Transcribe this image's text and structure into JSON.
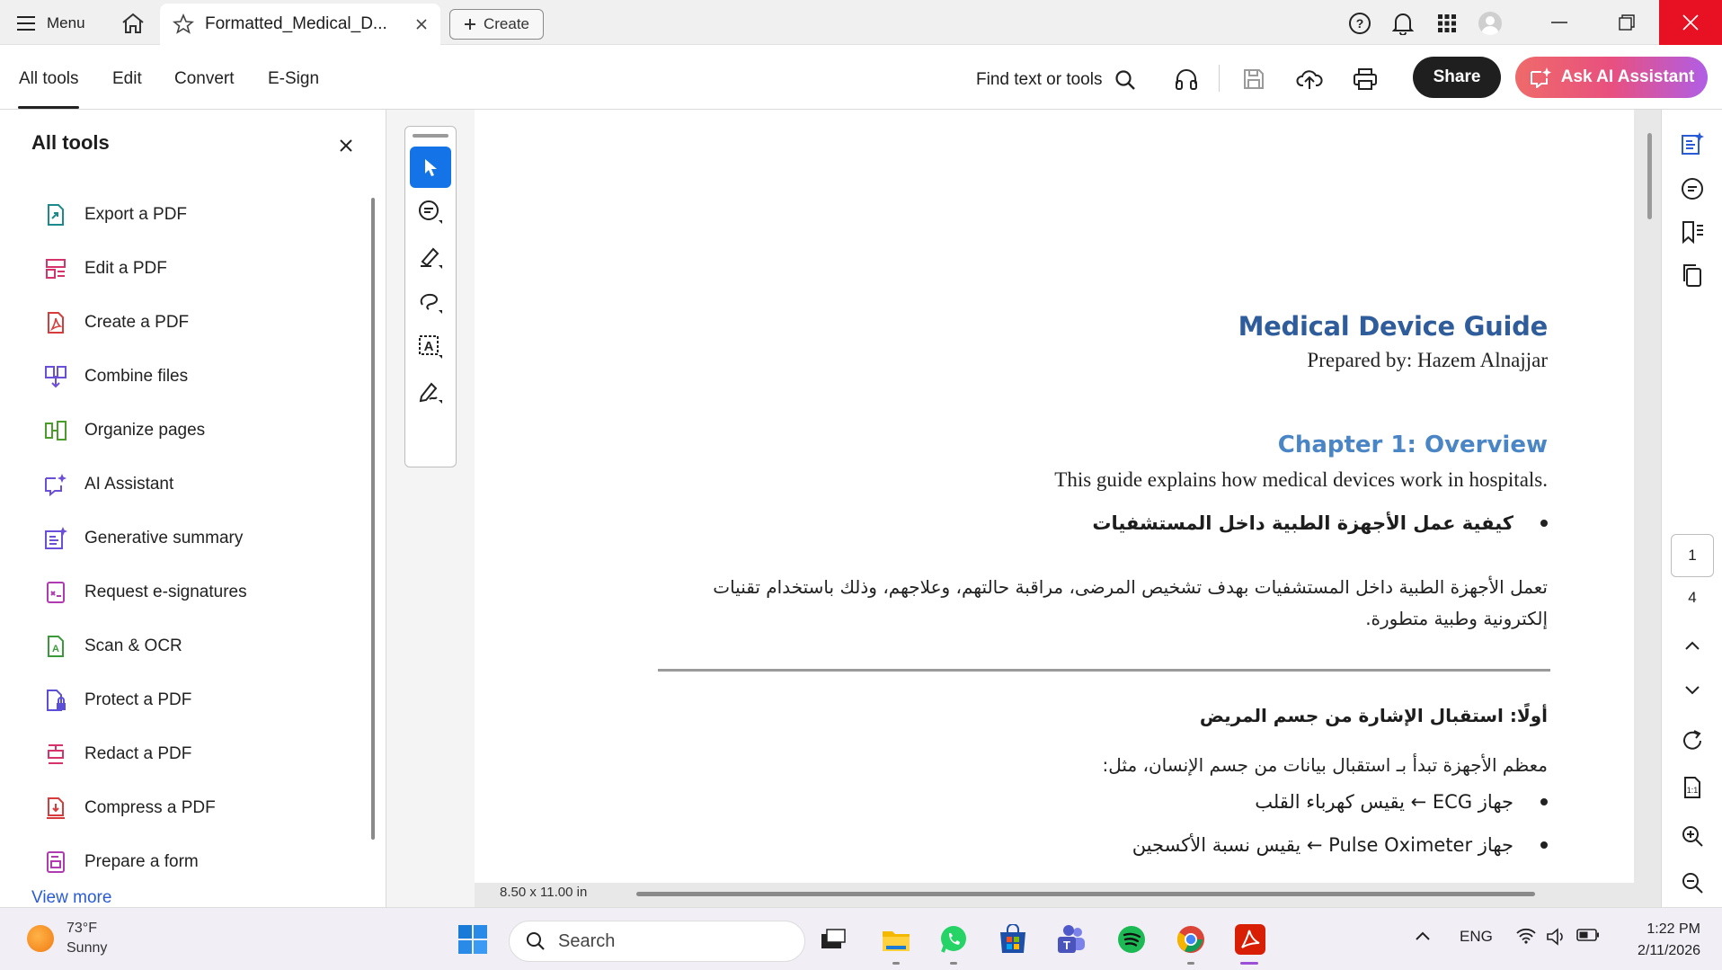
{
  "titlebar": {
    "menu_label": "Menu",
    "doc_tab_title": "Formatted_Medical_D...",
    "create_label": "Create"
  },
  "toolbar": {
    "tabs": [
      "All tools",
      "Edit",
      "Convert",
      "E-Sign"
    ],
    "find_label": "Find text or tools",
    "share_label": "Share",
    "ai_label": "Ask AI Assistant"
  },
  "left_panel": {
    "title": "All tools",
    "items": [
      {
        "label": "Export a PDF",
        "icon": "export-pdf-icon",
        "color": "#1a8a8a"
      },
      {
        "label": "Edit a PDF",
        "icon": "edit-pdf-icon",
        "color": "#d6336c"
      },
      {
        "label": "Create a PDF",
        "icon": "create-pdf-icon",
        "color": "#d83b3b"
      },
      {
        "label": "Combine files",
        "icon": "combine-files-icon",
        "color": "#6b4fd8"
      },
      {
        "label": "Organize pages",
        "icon": "organize-pages-icon",
        "color": "#4a9d2a"
      },
      {
        "label": "AI Assistant",
        "icon": "ai-assistant-icon",
        "color": "#6b4fd8"
      },
      {
        "label": "Generative summary",
        "icon": "generative-summary-icon",
        "color": "#6b4fd8"
      },
      {
        "label": "Request e-signatures",
        "icon": "request-esignatures-icon",
        "color": "#b03ab0"
      },
      {
        "label": "Scan & OCR",
        "icon": "scan-ocr-icon",
        "color": "#3a9a3a"
      },
      {
        "label": "Protect a PDF",
        "icon": "protect-pdf-icon",
        "color": "#5b4fd8"
      },
      {
        "label": "Redact a PDF",
        "icon": "redact-pdf-icon",
        "color": "#d6336c"
      },
      {
        "label": "Compress a PDF",
        "icon": "compress-pdf-icon",
        "color": "#d83b3b"
      },
      {
        "label": "Prepare a form",
        "icon": "prepare-form-icon",
        "color": "#b03ab0"
      }
    ],
    "view_more": "View more"
  },
  "document": {
    "title": "Medical Device Guide",
    "author": "Prepared by: Hazem Alnajjar",
    "chapter": "Chapter 1: Overview",
    "intro": "This guide explains how medical devices work in hospitals.",
    "bullet1": "كيفية عمل الأجهزة الطبية داخل المستشفيات",
    "para1": "تعمل الأجهزة الطبية داخل المستشفيات بهدف تشخيص المرضى، مراقبة حالتهم، وعلاجهم، وذلك باستخدام تقنيات إلكترونية وطبية متطورة.",
    "heading1": "أولًا: استقبال الإشارة من جسم المريض",
    "para2": "معظم الأجهزة تبدأ بـ استقبال بيانات من جسم الإنسان، مثل:",
    "bullet2": "جهاز ECG ← يقيس كهرباء القلب",
    "bullet3": "جهاز Pulse Oximeter ← يقيس نسبة الأكسجين",
    "page_size": "8.50 x 11.00 in"
  },
  "page_nav": {
    "current": "1",
    "total": "4"
  },
  "taskbar": {
    "temperature": "73°F",
    "condition": "Sunny",
    "search_placeholder": "Search",
    "language": "ENG",
    "time": "1:22 PM",
    "date": "2/11/2026"
  },
  "colors": {
    "accent_blue": "#1473e6",
    "doc_title": "#2f5c9a",
    "chapter": "#4a86c5",
    "close_red": "#e81123"
  }
}
